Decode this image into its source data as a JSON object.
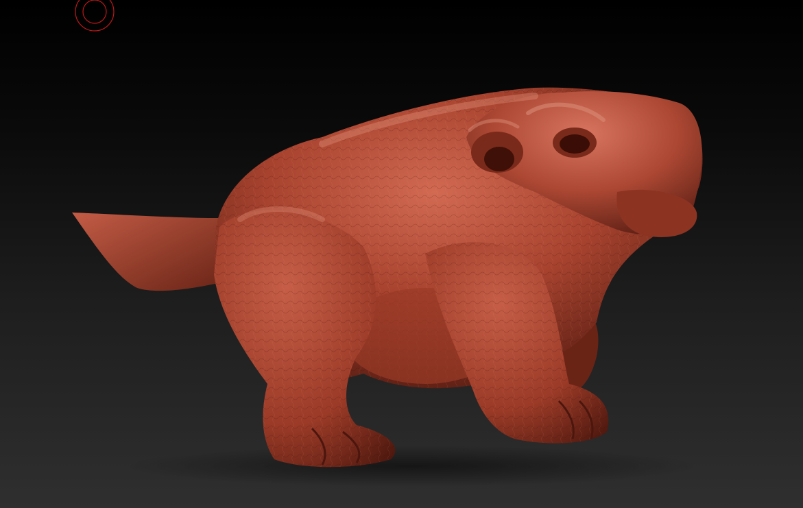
{
  "viewport": {
    "background_top": "#000000",
    "background_bottom": "#2f2f2f"
  },
  "brush_cursor": {
    "icon": "brush-circle-icon",
    "color": "#c01818"
  },
  "model": {
    "material_color": "#a8432f",
    "material_highlight": "#d26a52",
    "material_shadow": "#4a160d"
  }
}
